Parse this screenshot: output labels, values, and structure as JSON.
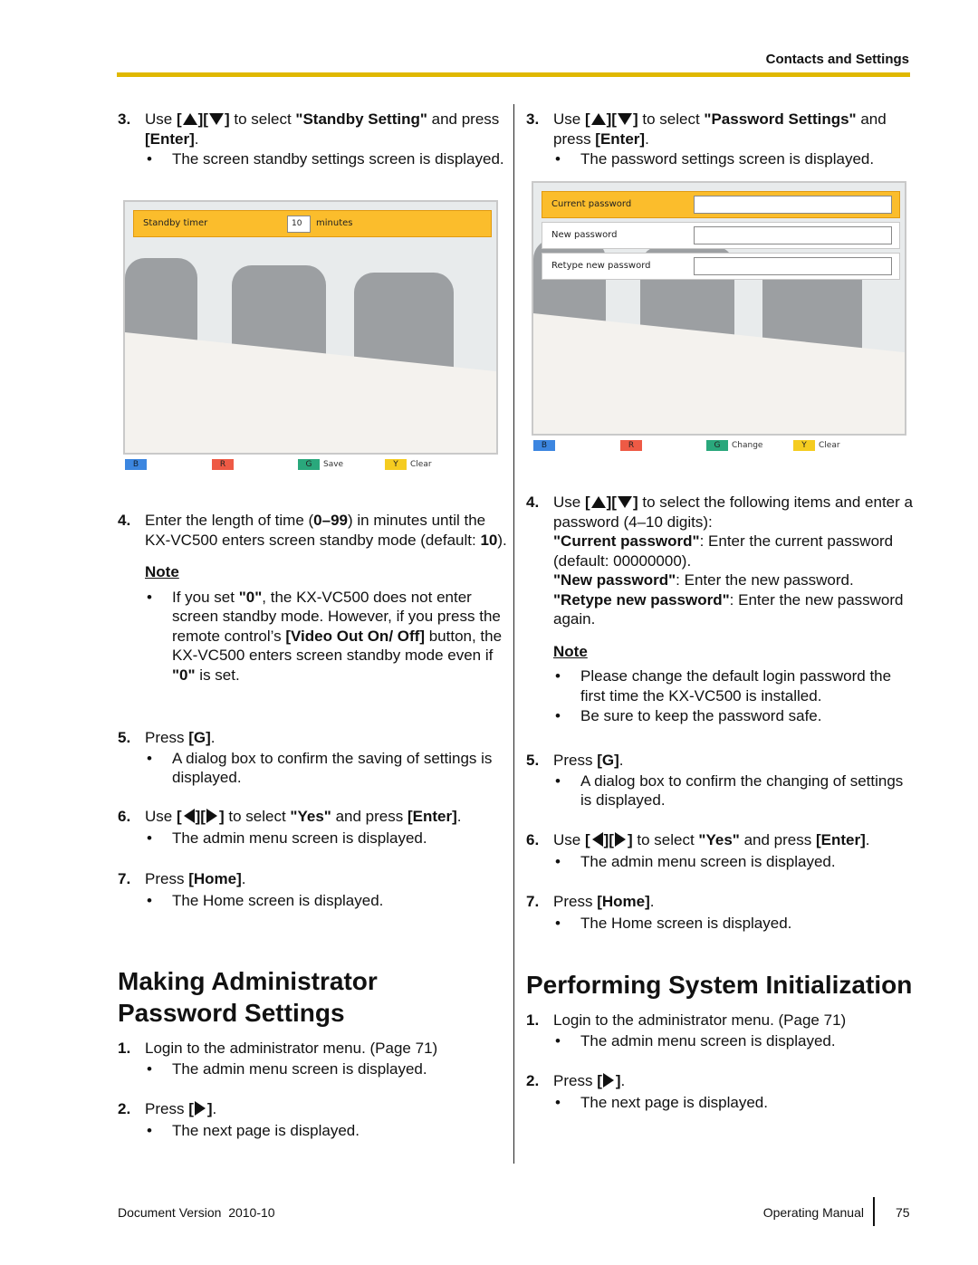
{
  "header": {
    "section_title": "Contacts and Settings",
    "rule_color": "#e0b800"
  },
  "left_column": {
    "step3": {
      "num": "3.",
      "parts": [
        "Use ",
        "[",
        "][",
        "]",
        " to select ",
        "\"Standby Setting\"",
        " and press ",
        "[Enter]",
        "."
      ],
      "bullet": "The screen standby settings screen is displayed."
    },
    "standby_screen": {
      "field_label": "Standby timer",
      "field_value": "10",
      "field_unit": "minutes",
      "keys": [
        {
          "key": "B",
          "label": "",
          "color": "#3c86e0"
        },
        {
          "key": "R",
          "label": "",
          "color": "#ee5a45"
        },
        {
          "key": "G",
          "label": "Save",
          "color": "#2aa87c"
        },
        {
          "key": "Y",
          "label": "Clear",
          "color": "#f5cc20"
        }
      ]
    },
    "step4": {
      "num": "4.",
      "text_a": "Enter the length of time (",
      "range": "0–99",
      "text_b": ") in minutes until the KX-VC500 enters screen standby mode (default: ",
      "default": "10",
      "text_c": ").",
      "note_title": "Note",
      "note": {
        "a": "If you set ",
        "zero1": "\"0\"",
        "b": ", the KX-VC500 does not enter screen standby mode. However, if you press the remote control’s ",
        "button": "[Video Out On/ Off]",
        "c": " button, the KX-VC500 enters screen standby mode even if ",
        "zero2": "\"0\"",
        "d": " is set."
      }
    },
    "step5": {
      "num": "5.",
      "text": "Press ",
      "key": "[G]",
      "end": ".",
      "bullet": "A dialog box to confirm the saving of settings is displayed."
    },
    "step6": {
      "num": "6.",
      "use": "Use ",
      "open": "[",
      "mid": "][",
      "close": "]",
      "text": " to select ",
      "yes": "\"Yes\"",
      "and_press": " and press ",
      "enter": "[Enter]",
      "end": ".",
      "bullet": "The admin menu screen is displayed."
    },
    "step7": {
      "num": "7.",
      "text": "Press ",
      "key": "[Home]",
      "end": ".",
      "bullet": "The Home screen is displayed."
    },
    "section": {
      "title_line1": "Making Administrator",
      "title_line2": "Password Settings",
      "step1": {
        "num": "1.",
        "text": "Login to the administrator menu. (Page 71)",
        "bullet": "The admin menu screen is displayed."
      },
      "step2": {
        "num": "2.",
        "text": "Press ",
        "open": "[",
        "close": "]",
        "end": ".",
        "bullet": "The next page is displayed."
      }
    }
  },
  "right_column": {
    "step3": {
      "num": "3.",
      "use": "Use ",
      "open": "[",
      "mid": "][",
      "close": "]",
      "text": " to select ",
      "target": "\"Password Settings\"",
      "and_press": " and press ",
      "enter": "[Enter]",
      "end": ".",
      "bullet": "The password settings screen is displayed."
    },
    "password_screen": {
      "fields": [
        {
          "label": "Current password",
          "value": "",
          "selected": true
        },
        {
          "label": "New password",
          "value": "",
          "selected": false
        },
        {
          "label": "Retype new password",
          "value": "",
          "selected": false
        }
      ],
      "keys": [
        {
          "key": "B",
          "label": "",
          "color": "#3c86e0"
        },
        {
          "key": "R",
          "label": "",
          "color": "#ee5a45"
        },
        {
          "key": "G",
          "label": "Change",
          "color": "#2aa87c"
        },
        {
          "key": "Y",
          "label": "Clear",
          "color": "#f5cc20"
        }
      ]
    },
    "step4": {
      "num": "4.",
      "use": "Use ",
      "open": "[",
      "mid": "][",
      "close": "]",
      "text": " to select the following items and enter a password (4–10 digits):",
      "items": [
        {
          "name": "\"Current password\"",
          "desc": ": Enter the current password (default: 00000000)."
        },
        {
          "name": "\"New password\"",
          "desc": ": Enter the new password."
        },
        {
          "name": "\"Retype new password\"",
          "desc": ": Enter the new password again."
        }
      ],
      "note_title": "Note",
      "notes": [
        "Please change the default login password the first time the KX-VC500 is installed.",
        "Be sure to keep the password safe."
      ]
    },
    "step5": {
      "num": "5.",
      "text": "Press ",
      "key": "[G]",
      "end": ".",
      "bullet": "A dialog box to confirm the changing of settings is displayed."
    },
    "step6": {
      "num": "6.",
      "use": "Use ",
      "open": "[",
      "mid": "][",
      "close": "]",
      "text": " to select ",
      "yes": "\"Yes\"",
      "and_press": " and press ",
      "enter": "[Enter]",
      "end": ".",
      "bullet": "The admin menu screen is displayed."
    },
    "step7": {
      "num": "7.",
      "text": "Press ",
      "key": "[Home]",
      "end": ".",
      "bullet": "The Home screen is displayed."
    },
    "section": {
      "title": "Performing System Initialization",
      "step1": {
        "num": "1.",
        "text": "Login to the administrator menu. (Page 71)",
        "bullet": "The admin menu screen is displayed."
      },
      "step2": {
        "num": "2.",
        "text": "Press ",
        "open": "[",
        "close": "]",
        "end": ".",
        "bullet": "The next page is displayed."
      }
    }
  },
  "footer": {
    "doc_version_label": "Document Version",
    "doc_version": "2010-10",
    "manual": "Operating Manual",
    "page": "75"
  }
}
